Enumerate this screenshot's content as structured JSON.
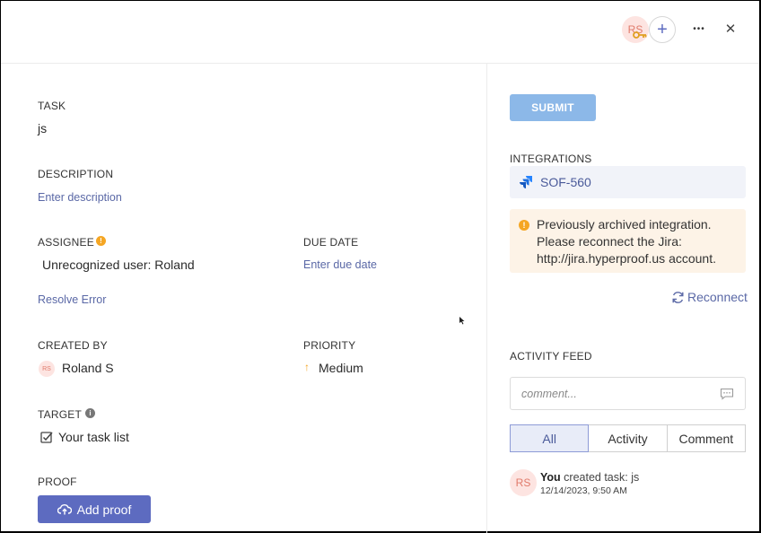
{
  "header": {
    "avatar_initials": "RS",
    "add_symbol": "+",
    "more_symbol": "•••",
    "close_symbol": "✕"
  },
  "task": {
    "label": "TASK",
    "value": "js"
  },
  "description": {
    "label": "DESCRIPTION",
    "placeholder": "Enter description"
  },
  "assignee": {
    "label": "ASSIGNEE",
    "info_symbol": "!",
    "value": "Unrecognized user: Roland",
    "resolve_link": "Resolve Error"
  },
  "due_date": {
    "label": "DUE DATE",
    "placeholder": "Enter due date"
  },
  "created_by": {
    "label": "CREATED BY",
    "avatar_initials": "RS",
    "value": "Roland S"
  },
  "priority": {
    "label": "PRIORITY",
    "value": "Medium",
    "arrow_symbol": "↑",
    "color": "#f5a623"
  },
  "target": {
    "label": "TARGET",
    "info_symbol": "i",
    "value": "Your task list"
  },
  "proof": {
    "label": "PROOF",
    "button_label": "Add proof"
  },
  "right": {
    "submit_label": "SUBMIT",
    "integrations_label": "INTEGRATIONS",
    "integration_id": "SOF-560",
    "warning_symbol": "!",
    "warning_lines": [
      "Previously archived integration.",
      "Please reconnect the Jira:",
      "http://jira.hyperproof.us account."
    ],
    "reconnect_label": "Reconnect",
    "activity_label": "ACTIVITY FEED",
    "comment_placeholder": "comment...",
    "tabs": [
      {
        "label": "All",
        "active": true
      },
      {
        "label": "Activity",
        "active": false
      },
      {
        "label": "Comment",
        "active": false
      }
    ],
    "feed": {
      "avatar_initials": "RS",
      "user": "You",
      "action": " created task: js",
      "timestamp": "12/14/2023, 9:50 AM"
    }
  },
  "colors": {
    "accent": "#5d6bc0",
    "link": "#5a68a6",
    "submit_disabled": "#8cb8e8",
    "warning_bg": "#fdf3e7",
    "warning": "#f5a623",
    "avatar_bg": "#fde4e1",
    "avatar_text": "#e07a6b"
  }
}
